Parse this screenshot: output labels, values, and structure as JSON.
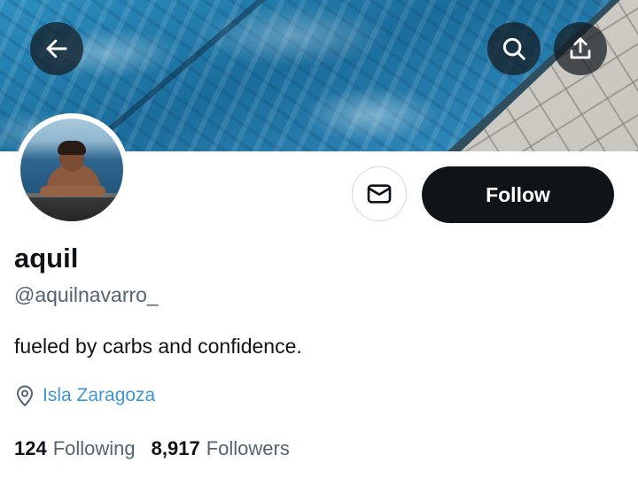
{
  "header": {
    "back_icon": "arrow-left-icon",
    "search_icon": "search-icon",
    "share_icon": "share-upload-icon",
    "banner_description": "swimming pool water"
  },
  "profile": {
    "display_name": "aquil",
    "handle": "@aquilnavarro_",
    "bio": "fueled by carbs and confidence.",
    "location": "Isla Zaragoza",
    "location_icon": "location-pin-icon"
  },
  "actions": {
    "message_icon": "envelope-icon",
    "follow_label": "Follow"
  },
  "stats": {
    "following_count": "124",
    "following_label": "Following",
    "followers_count": "8,917",
    "followers_label": "Followers"
  },
  "colors": {
    "button_dark": "#0f1419",
    "link_blue": "#1d9bf0",
    "secondary_text": "#536471"
  }
}
